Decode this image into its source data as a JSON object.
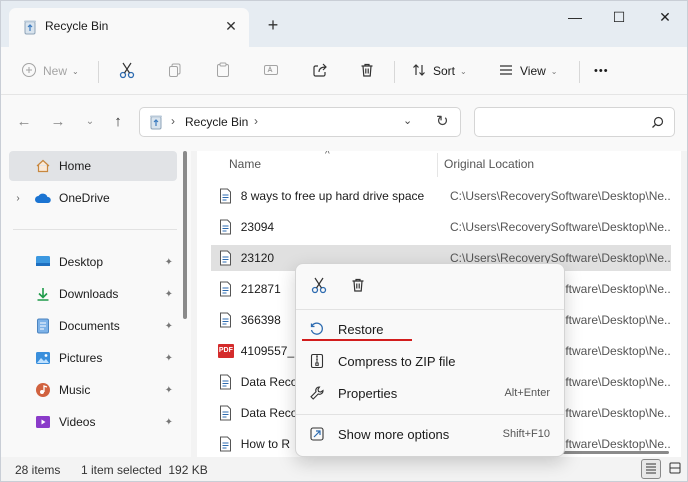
{
  "window": {
    "tab_title": "Recycle Bin",
    "tab_close": "✕",
    "new_tab": "+",
    "minimize": "—",
    "maximize": "☐",
    "close": "✕"
  },
  "toolbar": {
    "new_label": "New",
    "sort_label": "Sort",
    "view_label": "View",
    "more": "•••",
    "chevron": "⌄"
  },
  "address": {
    "path_sep": "›",
    "path": "Recycle Bin",
    "path_trailing_sep": "›",
    "search_placeholder": ""
  },
  "nav": {
    "items": [
      {
        "label": "Home",
        "icon": "home-icon",
        "selected": true
      },
      {
        "label": "OneDrive",
        "icon": "onedrive-icon",
        "expand": "›"
      },
      {
        "label": "Desktop",
        "icon": "desktop-icon",
        "pin": "📌"
      },
      {
        "label": "Downloads",
        "icon": "downloads-icon",
        "pin": "📌"
      },
      {
        "label": "Documents",
        "icon": "documents-icon",
        "pin": "📌"
      },
      {
        "label": "Pictures",
        "icon": "pictures-icon",
        "pin": "📌"
      },
      {
        "label": "Music",
        "icon": "music-icon",
        "pin": "📌"
      },
      {
        "label": "Videos",
        "icon": "videos-icon",
        "pin": "📌"
      }
    ]
  },
  "columns": {
    "name": "Name",
    "original_location": "Original Location"
  },
  "files": [
    {
      "name": "8 ways to free up hard drive space",
      "orig": "C:\\Users\\RecoverySoftware\\Desktop\\Ne...",
      "icon": "document-icon"
    },
    {
      "name": "23094",
      "orig": "C:\\Users\\RecoverySoftware\\Desktop\\Ne...",
      "icon": "document-icon"
    },
    {
      "name": "23120",
      "orig": "C:\\Users\\RecoverySoftware\\Desktop\\Ne...",
      "icon": "document-icon",
      "selected": true
    },
    {
      "name": "212871",
      "orig": "C:\\Users\\RecoverySoftware\\Desktop\\Ne...",
      "icon": "document-icon"
    },
    {
      "name": "366398",
      "orig": "C:\\Users\\RecoverySoftware\\Desktop\\Ne...",
      "icon": "document-icon"
    },
    {
      "name": "4109557_16",
      "orig": "C:\\Users\\RecoverySoftware\\Desktop\\Ne...",
      "icon": "pdf-icon"
    },
    {
      "name": "Data Recov",
      "orig": "C:\\Users\\RecoverySoftware\\Desktop\\Ne...",
      "icon": "document-icon"
    },
    {
      "name": "Data Recov",
      "orig": "C:\\Users\\RecoverySoftware\\Desktop\\Ne...",
      "icon": "document-icon"
    },
    {
      "name": "How to R",
      "orig": "C:\\Users\\RecoverySoftware\\Desktop\\Ne...",
      "icon": "document-icon"
    }
  ],
  "pdf_badge": "PDF",
  "status": {
    "count": "28 items",
    "selection": "1 item selected  192 KB"
  },
  "context_menu": {
    "items": [
      {
        "label": "Restore",
        "shortcut": "",
        "icon": "restore-icon"
      },
      {
        "label": "Compress to ZIP file",
        "shortcut": "",
        "icon": "zip-icon"
      },
      {
        "label": "Properties",
        "shortcut": "Alt+Enter",
        "icon": "properties-icon"
      },
      {
        "label": "Show more options",
        "shortcut": "Shift+F10",
        "icon": "more-options-icon"
      }
    ]
  },
  "colors": {
    "accent": "#0067c0",
    "highlight_underline": "#d21d1d",
    "selection": "#e0e0e0"
  }
}
